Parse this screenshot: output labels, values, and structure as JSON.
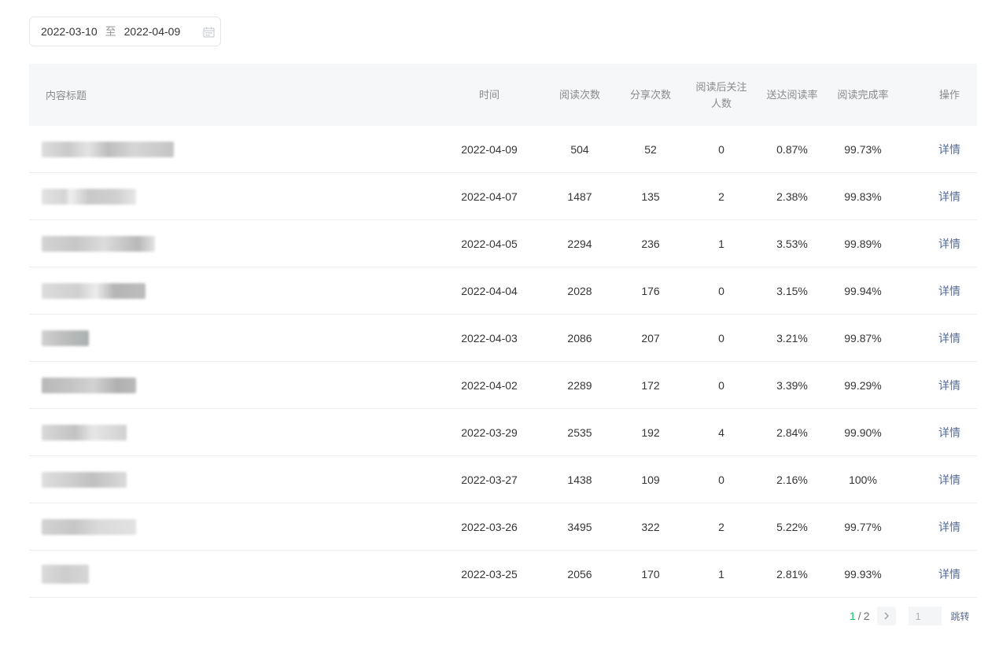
{
  "date_range": {
    "start": "2022-03-10",
    "separator": "至",
    "end": "2022-04-09"
  },
  "columns": {
    "title": "内容标题",
    "time": "时间",
    "reads": "阅读次数",
    "shares": "分享次数",
    "follows_line1": "阅读后关注",
    "follows_line2": "人数",
    "delivery_rate": "送达阅读率",
    "completion_rate": "阅读完成率",
    "action": "操作"
  },
  "rows": [
    {
      "time": "2022-04-09",
      "reads": "504",
      "shares": "52",
      "follows": "0",
      "delivery_rate": "0.87%",
      "completion_rate": "99.73%",
      "action": "详情"
    },
    {
      "time": "2022-04-07",
      "reads": "1487",
      "shares": "135",
      "follows": "2",
      "delivery_rate": "2.38%",
      "completion_rate": "99.83%",
      "action": "详情"
    },
    {
      "time": "2022-04-05",
      "reads": "2294",
      "shares": "236",
      "follows": "1",
      "delivery_rate": "3.53%",
      "completion_rate": "99.89%",
      "action": "详情"
    },
    {
      "time": "2022-04-04",
      "reads": "2028",
      "shares": "176",
      "follows": "0",
      "delivery_rate": "3.15%",
      "completion_rate": "99.94%",
      "action": "详情"
    },
    {
      "time": "2022-04-03",
      "reads": "2086",
      "shares": "207",
      "follows": "0",
      "delivery_rate": "3.21%",
      "completion_rate": "99.87%",
      "action": "详情"
    },
    {
      "time": "2022-04-02",
      "reads": "2289",
      "shares": "172",
      "follows": "0",
      "delivery_rate": "3.39%",
      "completion_rate": "99.29%",
      "action": "详情"
    },
    {
      "time": "2022-03-29",
      "reads": "2535",
      "shares": "192",
      "follows": "4",
      "delivery_rate": "2.84%",
      "completion_rate": "99.90%",
      "action": "详情"
    },
    {
      "time": "2022-03-27",
      "reads": "1438",
      "shares": "109",
      "follows": "0",
      "delivery_rate": "2.16%",
      "completion_rate": "100%",
      "action": "详情"
    },
    {
      "time": "2022-03-26",
      "reads": "3495",
      "shares": "322",
      "follows": "2",
      "delivery_rate": "5.22%",
      "completion_rate": "99.77%",
      "action": "详情"
    },
    {
      "time": "2022-03-25",
      "reads": "2056",
      "shares": "170",
      "follows": "1",
      "delivery_rate": "2.81%",
      "completion_rate": "99.93%",
      "action": "详情"
    }
  ],
  "pagination": {
    "current": "1",
    "separator": "/",
    "total": "2",
    "input_value": "1",
    "jump_label": "跳转"
  },
  "colors": {
    "accent": "#07c160",
    "link": "#576b95",
    "header_bg": "#f6f7f9"
  },
  "icons": {
    "calendar": "calendar-icon",
    "next": "chevron-right-icon"
  }
}
